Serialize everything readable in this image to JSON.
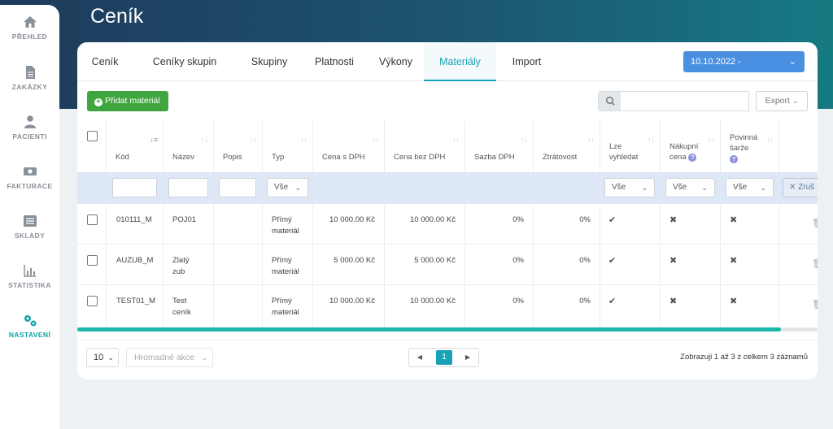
{
  "page": {
    "title": "Ceník"
  },
  "sidebar": {
    "items": [
      {
        "label": "PŘEHLED",
        "icon": "home-icon"
      },
      {
        "label": "ZAKÁZKY",
        "icon": "document-icon"
      },
      {
        "label": "PACIENTI",
        "icon": "user-icon"
      },
      {
        "label": "FAKTURACE",
        "icon": "money-icon"
      },
      {
        "label": "SKLADY",
        "icon": "list-icon"
      },
      {
        "label": "STATISTIKA",
        "icon": "chart-icon"
      },
      {
        "label": "NASTAVENÍ",
        "icon": "gears-icon"
      }
    ],
    "active_color": "#0fa3a6"
  },
  "tabs": [
    {
      "label": "Ceník"
    },
    {
      "label": "Ceníky skupin"
    },
    {
      "label": "Skupiny"
    },
    {
      "label": "Platnosti"
    },
    {
      "label": "Výkony"
    },
    {
      "label": "Materiály"
    },
    {
      "label": "Import"
    }
  ],
  "date_select": {
    "value": "10.10.2022 -"
  },
  "toolbar": {
    "add_label": "Přidat materiál",
    "export_label": "Export",
    "search_value": ""
  },
  "table": {
    "headers": {
      "kod": "Kód",
      "nazev": "Název",
      "popis": "Popis",
      "typ": "Typ",
      "cena_s": "Cena s DPH",
      "cena_bez": "Cena bez DPH",
      "sazba": "Sazba DPH",
      "ztratovost": "Ztrátovost",
      "lze_1": "Lze",
      "lze_2": "vyhledat",
      "nakupni_1": "Nákupní",
      "nakupni_2": "cena",
      "povinna_1": "Povinná",
      "povinna_2": "šarže"
    },
    "filters": {
      "typ": "Vše",
      "lze": "Vše",
      "nakupni": "Vše",
      "povinna": "Vše",
      "reset": "Zruš"
    },
    "rows": [
      {
        "kod": "010111_M",
        "nazev_1": "POJ01",
        "nazev_2": "",
        "typ_1": "Přímý",
        "typ_2": "materiál",
        "cena_s": "10 000.00 Kč",
        "cena_bez": "10 000.00 Kč",
        "sazba": "0%",
        "ztratovost": "0%",
        "lze": "✔",
        "nakupni": "✖",
        "povinna": "✖"
      },
      {
        "kod": "AUZUB_M",
        "nazev_1": "Zlatý",
        "nazev_2": "zub",
        "typ_1": "Přímý",
        "typ_2": "materiál",
        "cena_s": "5 000.00 Kč",
        "cena_bez": "5 000.00 Kč",
        "sazba": "0%",
        "ztratovost": "0%",
        "lze": "✔",
        "nakupni": "✖",
        "povinna": "✖"
      },
      {
        "kod": "TEST01_M",
        "nazev_1": "Test",
        "nazev_2": "ceník",
        "typ_1": "Přímý",
        "typ_2": "materiál",
        "cena_s": "10 000.00 Kč",
        "cena_bez": "10 000.00 Kč",
        "sazba": "0%",
        "ztratovost": "0%",
        "lze": "✔",
        "nakupni": "✖",
        "povinna": "✖"
      }
    ]
  },
  "footer": {
    "per_page": "10",
    "bulk_placeholder": "Hromadné akce",
    "current_page": "1",
    "info": "Zobrazuji 1 až 3 z celkem 3 záznamů"
  },
  "colors": {
    "accent": "#17a2b8",
    "add_button": "#3fa63f",
    "date_select": "#4a90e2",
    "scrollbar": "#1bb9aa"
  }
}
